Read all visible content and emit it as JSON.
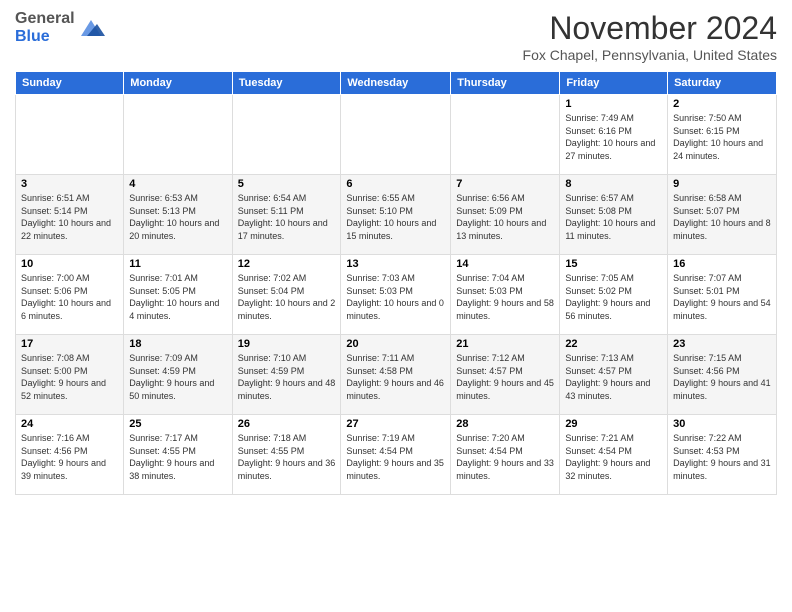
{
  "header": {
    "logo": {
      "general": "General",
      "blue": "Blue"
    },
    "title": "November 2024",
    "location": "Fox Chapel, Pennsylvania, United States"
  },
  "days_of_week": [
    "Sunday",
    "Monday",
    "Tuesday",
    "Wednesday",
    "Thursday",
    "Friday",
    "Saturday"
  ],
  "weeks": [
    [
      null,
      null,
      null,
      null,
      null,
      {
        "day": 1,
        "sunrise": "7:49 AM",
        "sunset": "6:16 PM",
        "daylight": "10 hours and 27 minutes."
      },
      {
        "day": 2,
        "sunrise": "7:50 AM",
        "sunset": "6:15 PM",
        "daylight": "10 hours and 24 minutes."
      }
    ],
    [
      {
        "day": 3,
        "sunrise": "6:51 AM",
        "sunset": "5:14 PM",
        "daylight": "10 hours and 22 minutes."
      },
      {
        "day": 4,
        "sunrise": "6:53 AM",
        "sunset": "5:13 PM",
        "daylight": "10 hours and 20 minutes."
      },
      {
        "day": 5,
        "sunrise": "6:54 AM",
        "sunset": "5:11 PM",
        "daylight": "10 hours and 17 minutes."
      },
      {
        "day": 6,
        "sunrise": "6:55 AM",
        "sunset": "5:10 PM",
        "daylight": "10 hours and 15 minutes."
      },
      {
        "day": 7,
        "sunrise": "6:56 AM",
        "sunset": "5:09 PM",
        "daylight": "10 hours and 13 minutes."
      },
      {
        "day": 8,
        "sunrise": "6:57 AM",
        "sunset": "5:08 PM",
        "daylight": "10 hours and 11 minutes."
      },
      {
        "day": 9,
        "sunrise": "6:58 AM",
        "sunset": "5:07 PM",
        "daylight": "10 hours and 8 minutes."
      }
    ],
    [
      {
        "day": 10,
        "sunrise": "7:00 AM",
        "sunset": "5:06 PM",
        "daylight": "10 hours and 6 minutes."
      },
      {
        "day": 11,
        "sunrise": "7:01 AM",
        "sunset": "5:05 PM",
        "daylight": "10 hours and 4 minutes."
      },
      {
        "day": 12,
        "sunrise": "7:02 AM",
        "sunset": "5:04 PM",
        "daylight": "10 hours and 2 minutes."
      },
      {
        "day": 13,
        "sunrise": "7:03 AM",
        "sunset": "5:03 PM",
        "daylight": "10 hours and 0 minutes."
      },
      {
        "day": 14,
        "sunrise": "7:04 AM",
        "sunset": "5:03 PM",
        "daylight": "9 hours and 58 minutes."
      },
      {
        "day": 15,
        "sunrise": "7:05 AM",
        "sunset": "5:02 PM",
        "daylight": "9 hours and 56 minutes."
      },
      {
        "day": 16,
        "sunrise": "7:07 AM",
        "sunset": "5:01 PM",
        "daylight": "9 hours and 54 minutes."
      }
    ],
    [
      {
        "day": 17,
        "sunrise": "7:08 AM",
        "sunset": "5:00 PM",
        "daylight": "9 hours and 52 minutes."
      },
      {
        "day": 18,
        "sunrise": "7:09 AM",
        "sunset": "4:59 PM",
        "daylight": "9 hours and 50 minutes."
      },
      {
        "day": 19,
        "sunrise": "7:10 AM",
        "sunset": "4:59 PM",
        "daylight": "9 hours and 48 minutes."
      },
      {
        "day": 20,
        "sunrise": "7:11 AM",
        "sunset": "4:58 PM",
        "daylight": "9 hours and 46 minutes."
      },
      {
        "day": 21,
        "sunrise": "7:12 AM",
        "sunset": "4:57 PM",
        "daylight": "9 hours and 45 minutes."
      },
      {
        "day": 22,
        "sunrise": "7:13 AM",
        "sunset": "4:57 PM",
        "daylight": "9 hours and 43 minutes."
      },
      {
        "day": 23,
        "sunrise": "7:15 AM",
        "sunset": "4:56 PM",
        "daylight": "9 hours and 41 minutes."
      }
    ],
    [
      {
        "day": 24,
        "sunrise": "7:16 AM",
        "sunset": "4:56 PM",
        "daylight": "9 hours and 39 minutes."
      },
      {
        "day": 25,
        "sunrise": "7:17 AM",
        "sunset": "4:55 PM",
        "daylight": "9 hours and 38 minutes."
      },
      {
        "day": 26,
        "sunrise": "7:18 AM",
        "sunset": "4:55 PM",
        "daylight": "9 hours and 36 minutes."
      },
      {
        "day": 27,
        "sunrise": "7:19 AM",
        "sunset": "4:54 PM",
        "daylight": "9 hours and 35 minutes."
      },
      {
        "day": 28,
        "sunrise": "7:20 AM",
        "sunset": "4:54 PM",
        "daylight": "9 hours and 33 minutes."
      },
      {
        "day": 29,
        "sunrise": "7:21 AM",
        "sunset": "4:54 PM",
        "daylight": "9 hours and 32 minutes."
      },
      {
        "day": 30,
        "sunrise": "7:22 AM",
        "sunset": "4:53 PM",
        "daylight": "9 hours and 31 minutes."
      }
    ]
  ]
}
